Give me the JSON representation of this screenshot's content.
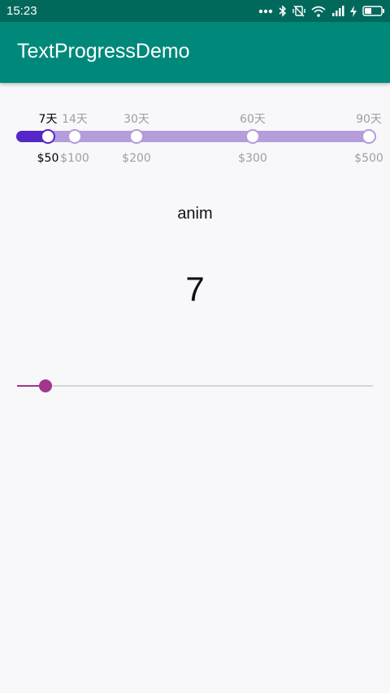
{
  "status_bar": {
    "time": "15:23",
    "icons": [
      "more-dots-icon",
      "bluetooth-icon",
      "vibrate-icon",
      "wifi-icon",
      "signal-icon",
      "charging-icon",
      "battery-icon"
    ]
  },
  "app_bar": {
    "title": "TextProgressDemo"
  },
  "step_progress": {
    "top_labels": [
      "7天",
      "14天",
      "30天",
      "60天",
      "90天"
    ],
    "bottom_labels": [
      "$50",
      "$100",
      "$200",
      "$300",
      "$500"
    ],
    "active_index": 0,
    "colors": {
      "active": "#5526c8",
      "inactive": "#b39ddb",
      "active_text": "#000000",
      "inactive_text": "#9e9e9e"
    }
  },
  "anim_button": {
    "label": "anim"
  },
  "value_display": {
    "value": "7"
  },
  "seekbar": {
    "progress_fraction": 0.08,
    "color": "#a2358c"
  },
  "colors": {
    "status_bar": "#00695c",
    "app_bar": "#00897b",
    "background": "#f8f7fa"
  }
}
